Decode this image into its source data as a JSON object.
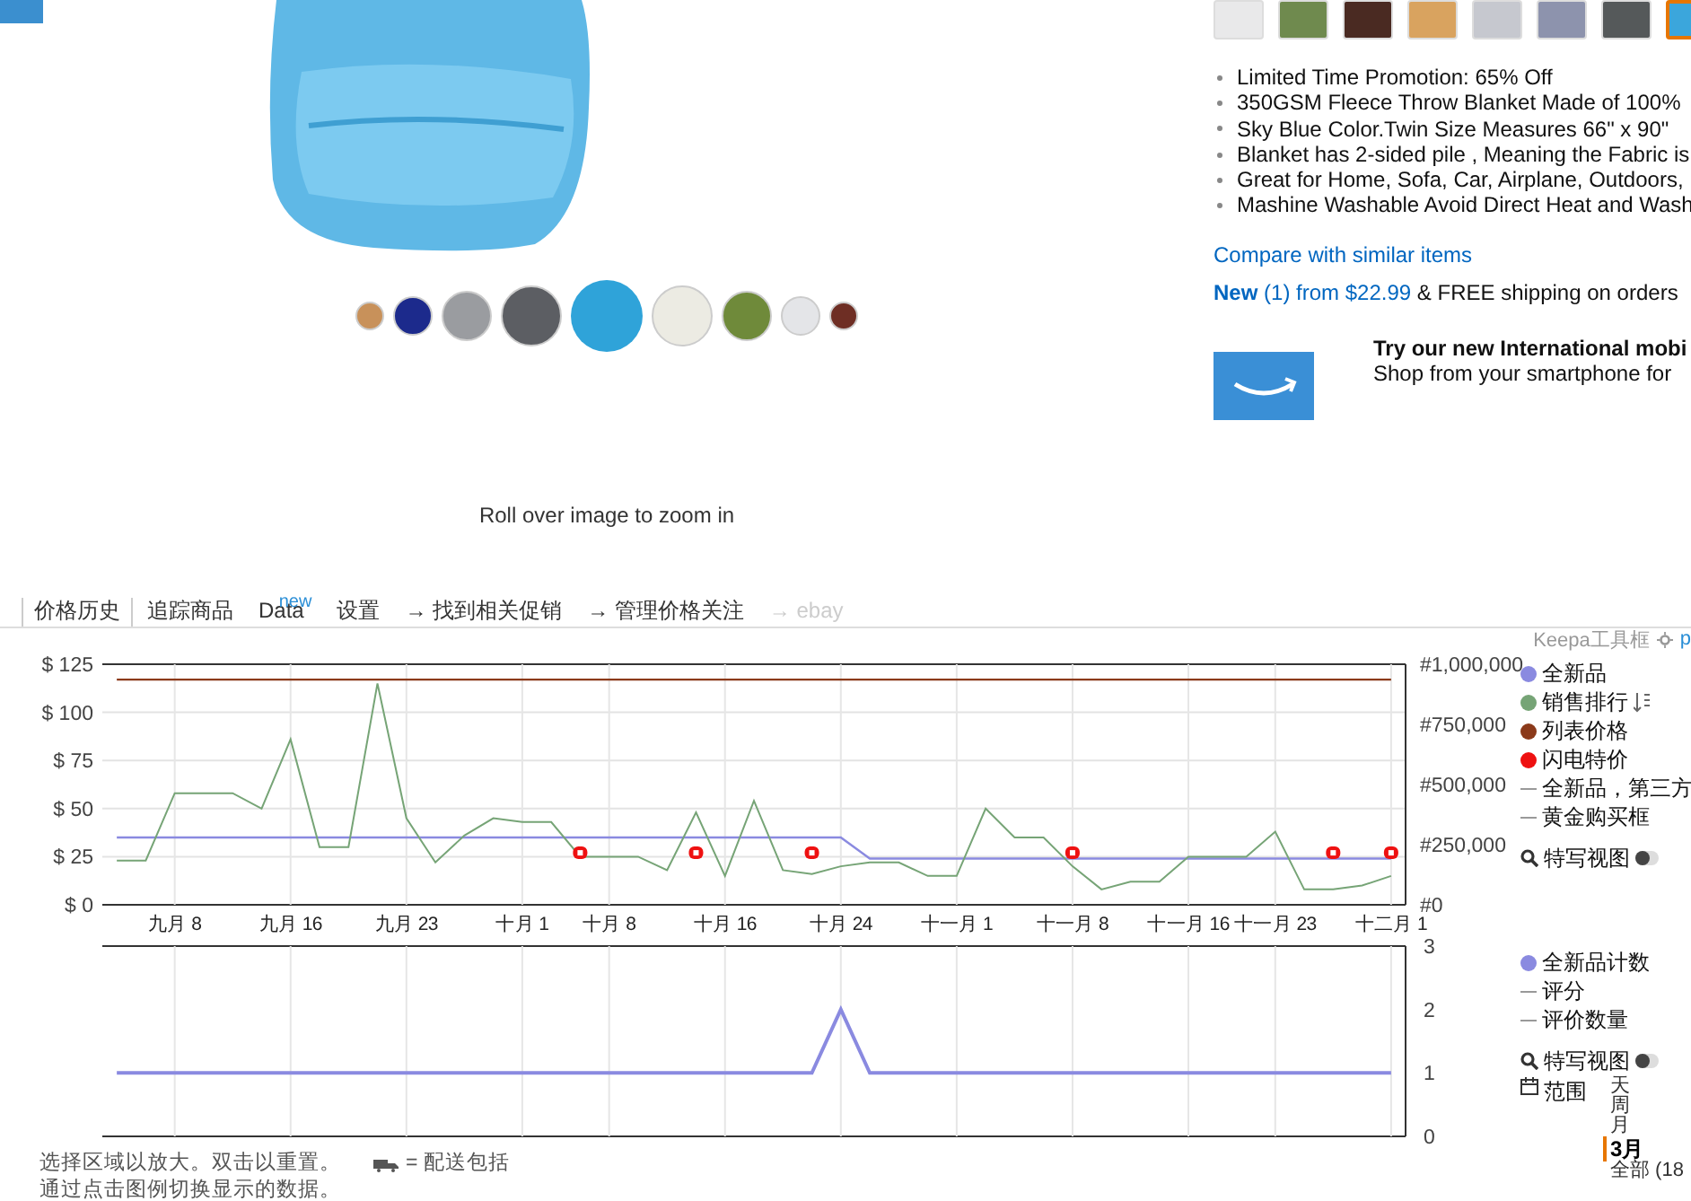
{
  "product": {
    "color_dots": [
      {
        "color": "#c8915a",
        "selected": false
      },
      {
        "color": "#1c2a8c",
        "selected": false
      },
      {
        "color": "#9a9ca0",
        "selected": false
      },
      {
        "color": "#5c5e63",
        "selected": false
      },
      {
        "color": "#2fa3d9",
        "selected": true
      },
      {
        "color": "#ecebe3",
        "selected": false
      },
      {
        "color": "#6f8a3a",
        "selected": false
      },
      {
        "color": "#e4e5e8",
        "selected": false
      },
      {
        "color": "#6e2e24",
        "selected": false
      }
    ],
    "zoom_hint": "Roll over image to zoom in",
    "swatches": [
      {
        "color": "#e9e9ea",
        "selected": false
      },
      {
        "color": "#6f8a4e",
        "selected": false
      },
      {
        "color": "#4a2a22",
        "selected": false
      },
      {
        "color": "#d9a35f",
        "selected": false
      },
      {
        "color": "#c6c8cf",
        "selected": false
      },
      {
        "color": "#8d93ad",
        "selected": false
      },
      {
        "color": "#55595a",
        "selected": false
      },
      {
        "color": "#3ba6dc",
        "selected": true
      }
    ],
    "bullets": [
      "Limited Time Promotion: 65% Off",
      "350GSM Fleece Throw Blanket Made of 100%",
      "Sky Blue Color.Twin Size Measures 66\" x 90\"",
      "Blanket has 2-sided pile , Meaning the Fabric is",
      "Great for Home, Sofa, Car, Airplane, Outdoors,",
      "Mashine Washable Avoid Direct Heat and Wash"
    ],
    "compare_link": "Compare with similar items",
    "offer_link": "**New** (1) from $22.99",
    "offer_shipping": "& FREE shipping on orders",
    "app_promo": {
      "title": "Try our new International mobi",
      "text": "Shop from your smartphone for"
    }
  },
  "keepa": {
    "tabs": [
      {
        "label": "价格历史",
        "selected": true,
        "disabled": false
      },
      {
        "label": "追踪商品",
        "selected": false,
        "disabled": false
      },
      {
        "label": "Data",
        "badge": "new",
        "selected": false,
        "disabled": false
      },
      {
        "label": "设置",
        "selected": false,
        "disabled": false
      },
      {
        "label": "→ 找到相关促销",
        "selected": false,
        "disabled": false
      },
      {
        "label": "→ 管理价格关注",
        "selected": false,
        "disabled": false
      },
      {
        "label": "→ ebay",
        "selected": false,
        "disabled": true
      }
    ],
    "toolbar_label": "Keepa工具框",
    "toolbar_link": "p",
    "price_chart": {
      "chart_data": {
        "type": "line",
        "grid": true,
        "categories": [
          null,
          null,
          "九月 8",
          null,
          null,
          null,
          "九月 16",
          null,
          null,
          null,
          "九月 23",
          null,
          null,
          null,
          "十月 1",
          null,
          null,
          "十月 8",
          null,
          null,
          null,
          "十月 16",
          null,
          null,
          null,
          "十月 24",
          null,
          null,
          null,
          "十一月 1",
          null,
          null,
          null,
          "十一月 8",
          null,
          null,
          null,
          "十一月 16",
          null,
          null,
          "十一月 23",
          null,
          null,
          null,
          "十二月 1"
        ],
        "ylim": [
          0,
          125
        ],
        "y2lim": [
          0,
          1000000
        ],
        "yticks": [
          {
            "value": 0,
            "label": "$ 0"
          },
          {
            "value": 25,
            "label": "$ 25"
          },
          {
            "value": 50,
            "label": "$ 50"
          },
          {
            "value": 75,
            "label": "$ 75"
          },
          {
            "value": 100,
            "label": "$ 100"
          },
          {
            "value": 125,
            "label": "$ 125"
          }
        ],
        "y2ticks": [
          {
            "value": 0,
            "label": "#0"
          },
          {
            "value": 250000,
            "label": "#250,000"
          },
          {
            "value": 500000,
            "label": "#500,000"
          },
          {
            "value": 750000,
            "label": "#750,000"
          },
          {
            "value": 1000000,
            "label": "#1,000,000"
          }
        ],
        "series": [
          {
            "name": "全新品",
            "color": "#8a8ae0",
            "type": "line",
            "values": [
              35,
              35,
              35,
              35,
              35,
              35,
              35,
              35,
              35,
              35,
              35,
              35,
              35,
              35,
              35,
              35,
              35,
              35,
              35,
              35,
              35,
              35,
              35,
              35,
              35,
              35,
              24,
              24,
              24,
              24,
              24,
              24,
              24,
              24,
              24,
              24,
              24,
              24,
              24,
              24,
              24,
              24,
              24,
              24,
              24
            ]
          },
          {
            "name": "销售排行",
            "color": "#76a476",
            "type": "line",
            "axis": "y2",
            "values": [
              184000,
              184000,
              464000,
              464000,
              464000,
              400000,
              688000,
              240000,
              240000,
              920000,
              360000,
              176000,
              288000,
              360000,
              344000,
              344000,
              200000,
              200000,
              200000,
              144000,
              384000,
              120000,
              432000,
              144000,
              128000,
              160000,
              176000,
              176000,
              120000,
              120000,
              400000,
              280000,
              280000,
              160000,
              64000,
              96000,
              96000,
              200000,
              200000,
              200000,
              304000,
              64000,
              64000,
              80000,
              120000
            ]
          },
          {
            "name": "列表价格",
            "color": "#8b3a1a",
            "type": "line",
            "values": [
              117,
              117,
              117,
              117,
              117,
              117,
              117,
              117,
              117,
              117,
              117,
              117,
              117,
              117,
              117,
              117,
              117,
              117,
              117,
              117,
              117,
              117,
              117,
              117,
              117,
              117,
              117,
              117,
              117,
              117,
              117,
              117,
              117,
              117,
              117,
              117,
              117,
              117,
              117,
              117,
              117,
              117,
              117,
              117,
              117
            ]
          },
          {
            "name": "闪电特价",
            "color": "#ee1111",
            "type": "scatter",
            "values": [
              null,
              null,
              null,
              null,
              null,
              null,
              null,
              null,
              null,
              null,
              null,
              null,
              null,
              null,
              null,
              null,
              27,
              null,
              null,
              null,
              27,
              null,
              null,
              null,
              27,
              null,
              null,
              null,
              null,
              null,
              null,
              null,
              null,
              27,
              null,
              null,
              null,
              null,
              null,
              null,
              null,
              null,
              27,
              null,
              27
            ]
          }
        ]
      },
      "extra_legend": [
        {
          "name": "全新品，第三方",
          "on": false
        },
        {
          "name": "黄金购买框",
          "on": false
        }
      ],
      "closeup": {
        "label": "特写视图",
        "on": false
      }
    },
    "count_chart": {
      "chart_data": {
        "type": "line",
        "grid": true,
        "ylim": [
          0,
          3
        ],
        "yticks": [
          0,
          1,
          2,
          3
        ],
        "series": [
          {
            "name": "全新品计数",
            "color": "#8a8ae0",
            "type": "line",
            "values": [
              1,
              1,
              1,
              1,
              1,
              1,
              1,
              1,
              1,
              1,
              1,
              1,
              1,
              1,
              1,
              1,
              1,
              1,
              1,
              1,
              1,
              1,
              1,
              1,
              1,
              2,
              1,
              1,
              1,
              1,
              1,
              1,
              1,
              1,
              1,
              1,
              1,
              1,
              1,
              1,
              1,
              1,
              1,
              1,
              1
            ]
          }
        ]
      },
      "extra_legend": [
        {
          "name": "评分",
          "on": false
        },
        {
          "name": "评价数量",
          "on": false
        }
      ],
      "closeup": {
        "label": "特写视图",
        "on": false
      },
      "range_label": "范围",
      "ranges": [
        {
          "label": "天",
          "selected": false
        },
        {
          "label": "周",
          "selected": false
        },
        {
          "label": "月",
          "selected": false
        },
        {
          "label": "3月",
          "selected": true
        },
        {
          "label": "全部 (18",
          "selected": false
        }
      ]
    },
    "notes": [
      "选择区域以放大。双击以重置。",
      "= 配送包括",
      "通过点击图例切换显示的数据。"
    ]
  }
}
